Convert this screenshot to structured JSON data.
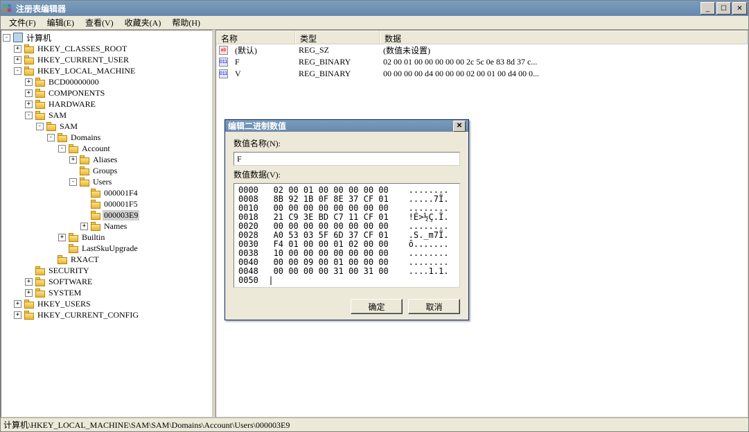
{
  "window": {
    "title": "注册表编辑器"
  },
  "menu": {
    "file": "文件(F)",
    "edit": "编辑(E)",
    "view": "查看(V)",
    "fav": "收藏夹(A)",
    "help": "帮助(H)"
  },
  "tree": {
    "root": "计算机",
    "hkcr": "HKEY_CLASSES_ROOT",
    "hkcu": "HKEY_CURRENT_USER",
    "hklm": "HKEY_LOCAL_MACHINE",
    "bcd": "BCD00000000",
    "comp": "COMPONENTS",
    "hw": "HARDWARE",
    "sam1": "SAM",
    "sam2": "SAM",
    "domains": "Domains",
    "account": "Account",
    "aliases": "Aliases",
    "groups": "Groups",
    "users": "Users",
    "u1f4": "000001F4",
    "u1f5": "000001F5",
    "u3e9": "000003E9",
    "names": "Names",
    "builtin": "Builtin",
    "lastsku": "LastSkuUpgrade",
    "rxact": "RXACT",
    "security": "SECURITY",
    "software": "SOFTWARE",
    "system": "SYSTEM",
    "hku": "HKEY_USERS",
    "hkcc": "HKEY_CURRENT_CONFIG",
    "plus": "+",
    "minus": "-"
  },
  "list": {
    "col_name": "名称",
    "col_type": "类型",
    "col_data": "数据",
    "rows": {
      "r0": {
        "name": "(默认)",
        "type": "REG_SZ",
        "data": "(数值未设置)"
      },
      "r1": {
        "name": "F",
        "type": "REG_BINARY",
        "data": "02 00 01 00 00 00 00 00 2c 5c 0e 83 8d 37 c..."
      },
      "r2": {
        "name": "V",
        "type": "REG_BINARY",
        "data": "00 00 00 00 d4 00 00 00 02 00 01 00 d4 00 0..."
      }
    }
  },
  "status": "计算机\\HKEY_LOCAL_MACHINE\\SAM\\SAM\\Domains\\Account\\Users\\000003E9",
  "dialog": {
    "title": "编辑二进制数值",
    "name_label": "数值名称(N):",
    "name_value": "F",
    "data_label": "数值数据(V):",
    "hex": "0000   02 00 01 00 00 00 00 00    ........\n0008   8B 92 1B 0F 8E 37 CF 01    .....7Ï.\n0010   00 00 00 00 00 00 00 00    ........\n0018   21 C9 3E BD C7 11 CF 01    !É>½Ç.Ï.\n0020   00 00 00 00 00 00 00 00    ........\n0028   A0 53 03 5F 6D 37 CF 01    .S._m7Ï.\n0030   F4 01 00 00 01 02 00 00    ô.......\n0038   10 00 00 00 00 00 00 00    ........\n0040   00 00 09 00 01 00 00 00    ........\n0048   00 00 00 00 31 00 31 00    ....1.1.\n0050  |",
    "ok": "确定",
    "cancel": "取消"
  }
}
